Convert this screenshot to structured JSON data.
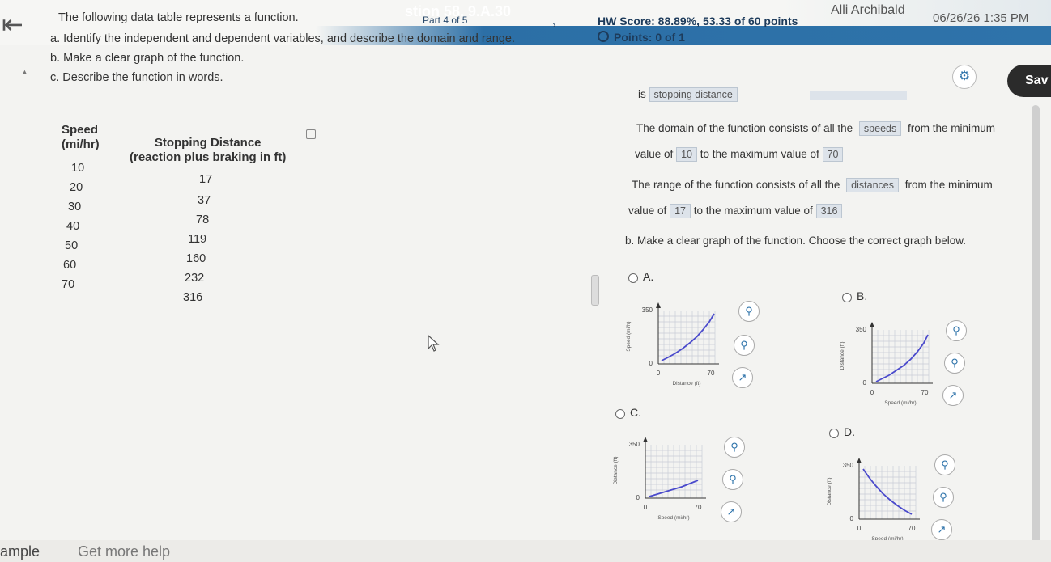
{
  "header": {
    "question_title": "stion 58, 9.A.30",
    "part_label": "Part 4 of 5",
    "hw_score": "HW Score: 88.89%, 53.33 of 60 points",
    "points": "Points: 0 of 1",
    "user_name": "Alli Archibald",
    "timestamp": "06/26/26 1:35 PM",
    "save_label": "Sav",
    "icons": {
      "back": "back-arrow-icon",
      "next": "chevron-right-icon",
      "settings": "gear-icon"
    },
    "colors": {
      "bar_blue": "#2e73aa",
      "save_dark": "#2b2b2b"
    }
  },
  "question": {
    "intro": "The following data table represents a function.",
    "part_a": "a. Identify the independent and dependent variables, and describe the domain and range.",
    "part_b": "b. Make a clear graph of the function.",
    "part_c": "c. Describe the function in words."
  },
  "table": {
    "col1_header_1": "Speed",
    "col1_header_2": "(mi/hr)",
    "col2_header_1": "Stopping Distance",
    "col2_header_2": "(reaction plus braking in ft)",
    "rows": [
      {
        "speed": "10",
        "distance": "17"
      },
      {
        "speed": "20",
        "distance": "37"
      },
      {
        "speed": "30",
        "distance": "78"
      },
      {
        "speed": "40",
        "distance": "119"
      },
      {
        "speed": "50",
        "distance": "160"
      },
      {
        "speed": "60",
        "distance": "232"
      },
      {
        "speed": "70",
        "distance": "316"
      }
    ]
  },
  "answers": {
    "dependent_prefix": "is",
    "dependent_value": "stopping distance",
    "domain_line1_prefix": "The domain of the function consists of all the",
    "domain_var": "speeds",
    "domain_line1_suffix": "from the minimum",
    "domain_line2_prefix": "value of",
    "domain_min": "10",
    "domain_line2_mid": "to the maximum value of",
    "domain_max": "70",
    "range_line1_prefix": "The range of the function consists of all the",
    "range_var": "distances",
    "range_line1_suffix": "from the minimum",
    "range_line2_prefix": "value of",
    "range_min": "17",
    "range_line2_mid": "to the maximum value of",
    "range_max": "316"
  },
  "part_b_prompt": "b. Make a clear graph of the function. Choose the correct graph below.",
  "options": [
    {
      "letter": "A.",
      "y_top": "350",
      "y_bottom": "0",
      "x_left": "0",
      "x_right": "70",
      "xlabel": "Distance (ft)",
      "ylabel": "Speed (mi/h)"
    },
    {
      "letter": "B.",
      "y_top": "350",
      "y_bottom": "0",
      "x_left": "0",
      "x_right": "70",
      "xlabel": "Speed (mi/hr)",
      "ylabel": "Distance (ft)"
    },
    {
      "letter": "C.",
      "y_top": "350",
      "y_bottom": "0",
      "x_left": "0",
      "x_right": "70",
      "xlabel": "Speed (mi/hr)",
      "ylabel": "Distance (ft)"
    },
    {
      "letter": "D.",
      "y_top": "350",
      "y_bottom": "0",
      "x_left": "0",
      "x_right": "70",
      "xlabel": "Speed (mi/hr)",
      "ylabel": "Distance (ft)"
    }
  ],
  "option_icons": [
    "zoom-in-icon",
    "zoom-out-icon",
    "open-new-window-icon"
  ],
  "bottom": {
    "example_label": "ample",
    "help_label": "Get more help"
  }
}
